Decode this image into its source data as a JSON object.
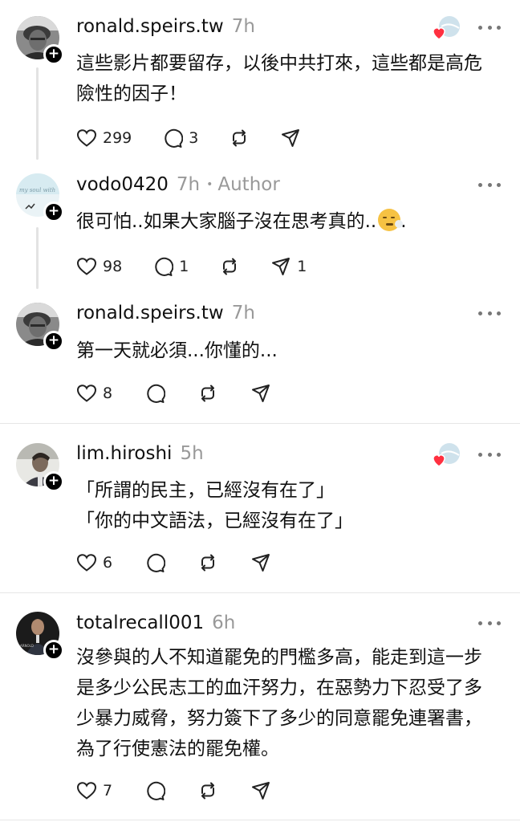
{
  "posts": [
    {
      "username": "ronald.speirs.tw",
      "time": "7h",
      "text": "這些影片都要留存，以後中共打來，這些都是高危\n險性的因子！",
      "likes": "299",
      "replies": "3",
      "reposts": "",
      "shares": "",
      "liked_indicator": true
    },
    {
      "username": "vodo0420",
      "time": "7h",
      "author_label": "Author",
      "text": "很可怕..如果大家腦子沒在思考真的..",
      "text_suffix": ".",
      "emoji": "face-exhaling-emoji",
      "likes": "98",
      "replies": "1",
      "reposts": "",
      "shares": "1"
    },
    {
      "username": "ronald.speirs.tw",
      "time": "7h",
      "text": "第一天就必須...你懂的...",
      "likes": "8",
      "replies": "",
      "reposts": "",
      "shares": ""
    },
    {
      "username": "lim.hiroshi",
      "time": "5h",
      "text": "「所謂的民主，已經沒有在了」\n「你的中文語法，已經沒有在了」",
      "likes": "6",
      "replies": "",
      "reposts": "",
      "shares": "",
      "liked_indicator": true
    },
    {
      "username": "totalrecall001",
      "time": "6h",
      "text": "沒參與的人不知道罷免的門檻多高，能走到這一步\n是多少公民志工的血汗努力，在惡勢力下忍受了多\n少暴力威脅，努力簽下了多少的同意罷免連署書，\n為了行使憲法的罷免權。",
      "likes": "7",
      "replies": "",
      "reposts": "",
      "shares": ""
    }
  ],
  "colors": {
    "text": "#111111",
    "muted": "#999999",
    "like_heart": "#ff3040",
    "divider": "#e6e6e6"
  },
  "icons": [
    "heart-icon",
    "comment-icon",
    "repost-icon",
    "share-icon",
    "more-icon",
    "follow-plus-icon"
  ]
}
